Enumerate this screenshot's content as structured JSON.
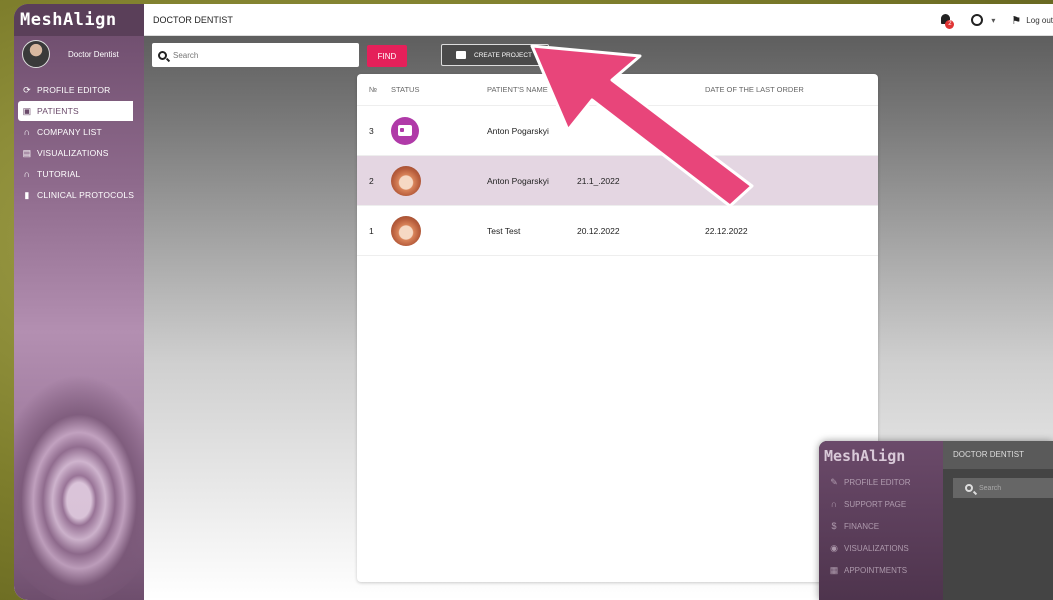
{
  "app": {
    "brand": "MeshAlign",
    "user_name": "Doctor Dentist",
    "topbar_title": "DOCTOR DENTIST",
    "bell_badge": "2",
    "logout_label": "Log out"
  },
  "sidebar": {
    "items": [
      {
        "label": "PROFILE EDITOR",
        "icon": "sync-icon"
      },
      {
        "label": "PATIENTS",
        "icon": "id-card-icon",
        "active": true
      },
      {
        "label": "COMPANY LIST",
        "icon": "headset-icon"
      },
      {
        "label": "VISUALIZATIONS",
        "icon": "grid-icon"
      },
      {
        "label": "TUTORIAL",
        "icon": "headset-icon"
      },
      {
        "label": "CLINICAL PROTOCOLS",
        "icon": "document-icon"
      }
    ]
  },
  "toolbar": {
    "search_placeholder": "Search",
    "find_label": "FIND",
    "create_label": "CREATE PROJECT"
  },
  "table": {
    "headers": [
      "№",
      "STATUS",
      "PATIENT'S NAME",
      "",
      "DATE OF THE LAST ORDER"
    ],
    "rows": [
      {
        "num": "3",
        "status": "purple-card",
        "name": "Anton Pogarskyi",
        "date1": "",
        "date2": ""
      },
      {
        "num": "2",
        "status": "orange-aligner",
        "name": "Anton Pogarskyi",
        "date1": "21.1_.2022",
        "date2": ""
      },
      {
        "num": "1",
        "status": "orange-aligner",
        "name": "Test Test",
        "date1": "20.12.2022",
        "date2": "22.12.2022"
      }
    ]
  },
  "mini_window": {
    "brand": "MeshAlign",
    "topbar_title": "DOCTOR DENTIST",
    "search_placeholder": "Search",
    "items": [
      {
        "label": "PROFILE EDITOR",
        "icon": "pencil-icon"
      },
      {
        "label": "SUPPORT PAGE",
        "icon": "headset-icon"
      },
      {
        "label": "FINANCE",
        "icon": "dollar-icon"
      },
      {
        "label": "VISUALIZATIONS",
        "icon": "eye-icon"
      },
      {
        "label": "APPOINTMENTS",
        "icon": "calendar-icon"
      }
    ]
  },
  "colors": {
    "accent": "#e5205a",
    "sidebar": "#8e6a8c",
    "selected_row": "#e4d6e2",
    "arrow": "#e8457a"
  }
}
